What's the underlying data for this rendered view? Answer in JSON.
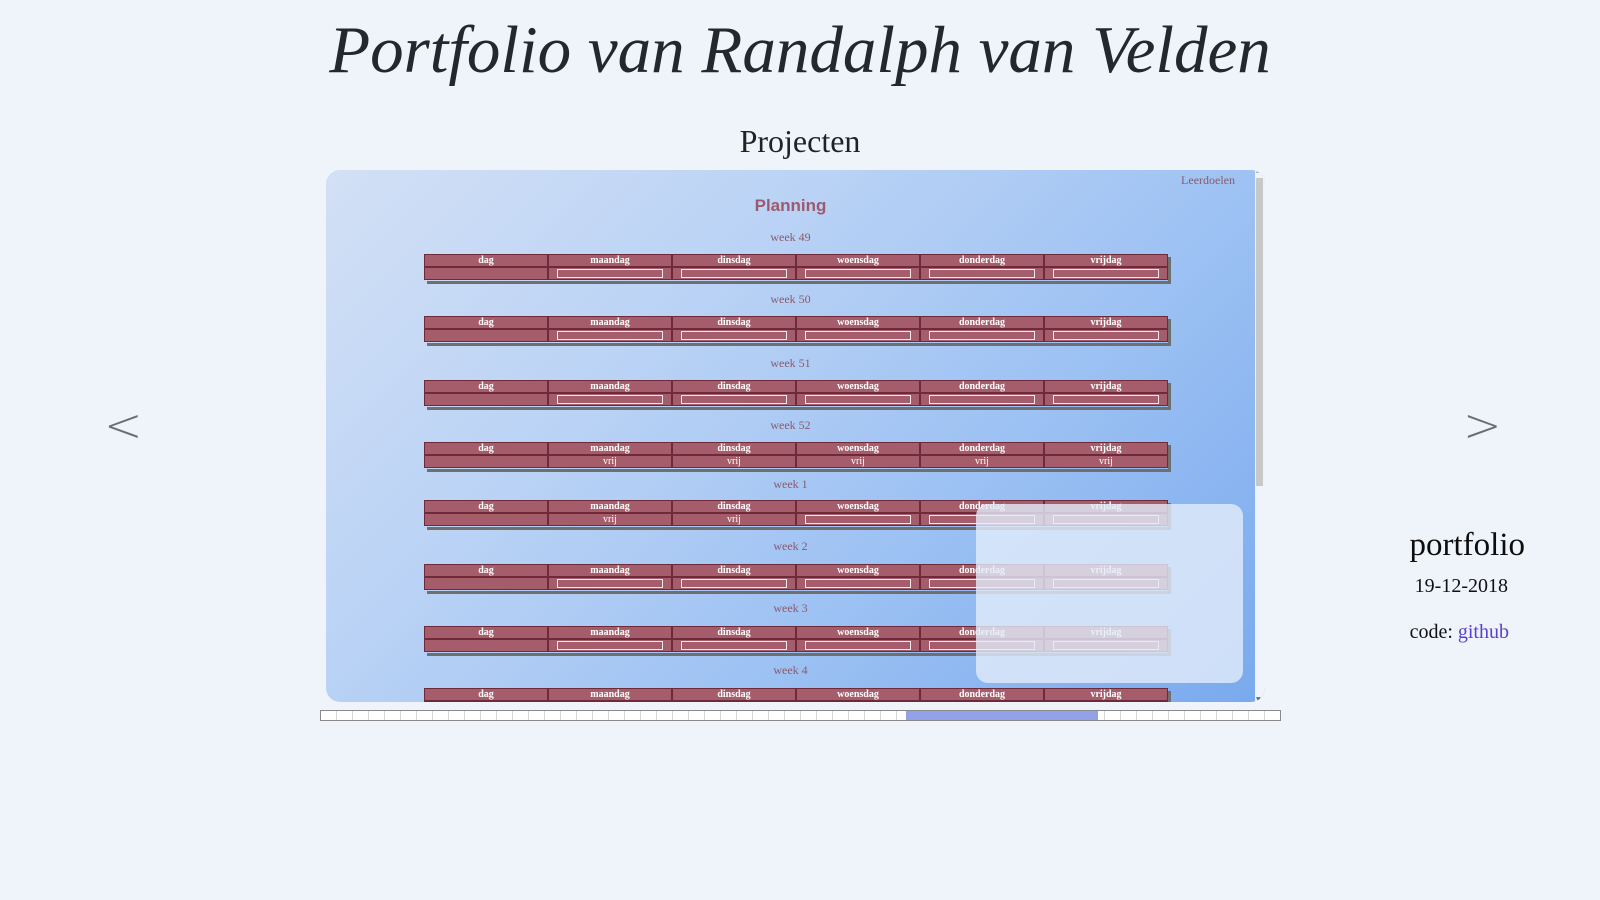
{
  "header": {
    "title": "Portfolio van Randalph van Velden",
    "section": "Projecten"
  },
  "nav": {
    "prev": "<",
    "next": ">"
  },
  "viewer": {
    "link_leerdoelen": "Leerdoelen",
    "planning_title": "Planning",
    "headers": [
      "dag",
      "maandag",
      "dinsdag",
      "woensdag",
      "donderdag",
      "vrijdag"
    ],
    "weeks": [
      {
        "label": "week 49",
        "cells": [
          "",
          "box",
          "box",
          "box",
          "box",
          "box"
        ]
      },
      {
        "label": "week 50",
        "cells": [
          "",
          "box",
          "box",
          "box",
          "box",
          "box"
        ]
      },
      {
        "label": "week 51",
        "cells": [
          "",
          "box",
          "box",
          "box",
          "box",
          "box"
        ]
      },
      {
        "label": "week 52",
        "cells": [
          "",
          "vrij",
          "vrij",
          "vrij",
          "vrij",
          "vrij"
        ]
      },
      {
        "label": "week 1",
        "cells": [
          "",
          "vrij",
          "vrij",
          "box",
          "box",
          "box"
        ]
      },
      {
        "label": "week 2",
        "cells": [
          "",
          "box",
          "box",
          "box",
          "box",
          "box"
        ]
      },
      {
        "label": "week 3",
        "cells": [
          "",
          "box",
          "box",
          "box",
          "box",
          "box"
        ]
      },
      {
        "label": "week 4",
        "cells": [
          "",
          "box",
          "box",
          "box",
          "box",
          "box"
        ]
      }
    ]
  },
  "card": {
    "title": "portfolio",
    "date": "19-12-2018",
    "code_label": "code:",
    "code_link": "github"
  },
  "progress": {
    "start": 0.61,
    "end": 0.81
  }
}
